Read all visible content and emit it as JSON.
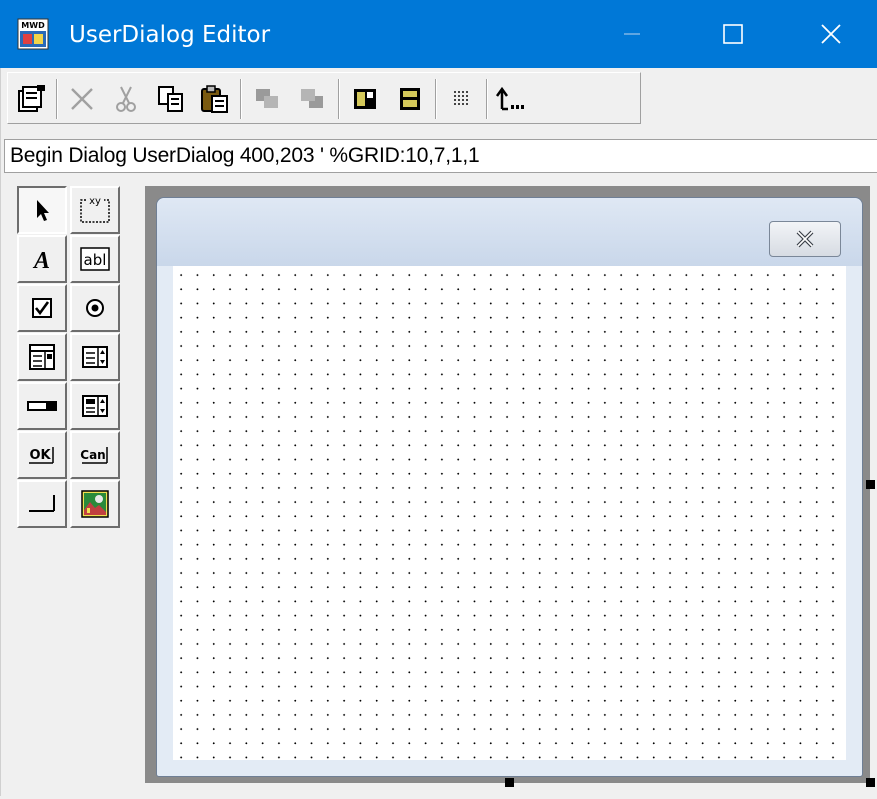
{
  "window": {
    "title": "UserDialog Editor",
    "app_icon": "mwd-app-icon",
    "controls": [
      "minimize-icon",
      "maximize-icon",
      "close-icon"
    ]
  },
  "toolbar": {
    "buttons": [
      {
        "name": "properties",
        "icon": "properties-icon",
        "enabled": true
      },
      {
        "name": "delete",
        "icon": "delete-icon",
        "enabled": false
      },
      {
        "name": "cut",
        "icon": "scissors-icon",
        "enabled": false
      },
      {
        "name": "copy",
        "icon": "copy-icon",
        "enabled": true
      },
      {
        "name": "paste",
        "icon": "paste-icon",
        "enabled": true
      },
      {
        "name": "bring-to-front",
        "icon": "bring-front-icon",
        "enabled": false
      },
      {
        "name": "send-to-back",
        "icon": "send-back-icon",
        "enabled": false
      },
      {
        "name": "align-left",
        "icon": "align-icon",
        "enabled": true
      },
      {
        "name": "size-same",
        "icon": "size-icon",
        "enabled": true
      },
      {
        "name": "grid",
        "icon": "grid-icon",
        "enabled": true
      },
      {
        "name": "exit-editor",
        "icon": "exit-icon",
        "enabled": true
      }
    ]
  },
  "code_line": "Begin Dialog UserDialog 400,203 ' %GRID:10,7,1,1",
  "toolbox": {
    "tools": [
      {
        "name": "pointer",
        "icon": "pointer-icon",
        "selected": true
      },
      {
        "name": "group-box",
        "label": "xy",
        "icon": "group-box-icon"
      },
      {
        "name": "text",
        "label": "A",
        "icon": "text-icon"
      },
      {
        "name": "text-box",
        "label": "abl",
        "icon": "textbox-icon"
      },
      {
        "name": "check-box",
        "icon": "checkbox-icon"
      },
      {
        "name": "option-button",
        "icon": "option-button-icon"
      },
      {
        "name": "list-box",
        "icon": "listbox-icon"
      },
      {
        "name": "combo-box",
        "icon": "combobox-icon"
      },
      {
        "name": "drop-list-box",
        "icon": "droplist-icon"
      },
      {
        "name": "drop-combo-box",
        "icon": "dropcombo-icon"
      },
      {
        "name": "ok-button",
        "label": "OK",
        "icon": "ok-button-icon"
      },
      {
        "name": "cancel-button",
        "label": "Can",
        "icon": "cancel-button-icon"
      },
      {
        "name": "push-button",
        "icon": "push-button-icon"
      },
      {
        "name": "picture",
        "icon": "picture-icon"
      }
    ]
  },
  "dialog": {
    "close_icon": "dialog-close-icon",
    "grid": true
  },
  "colors": {
    "titlebar": "#0078d7",
    "canvas_border": "#8a8a8a",
    "dialog_frame": "#e3ebf5"
  }
}
